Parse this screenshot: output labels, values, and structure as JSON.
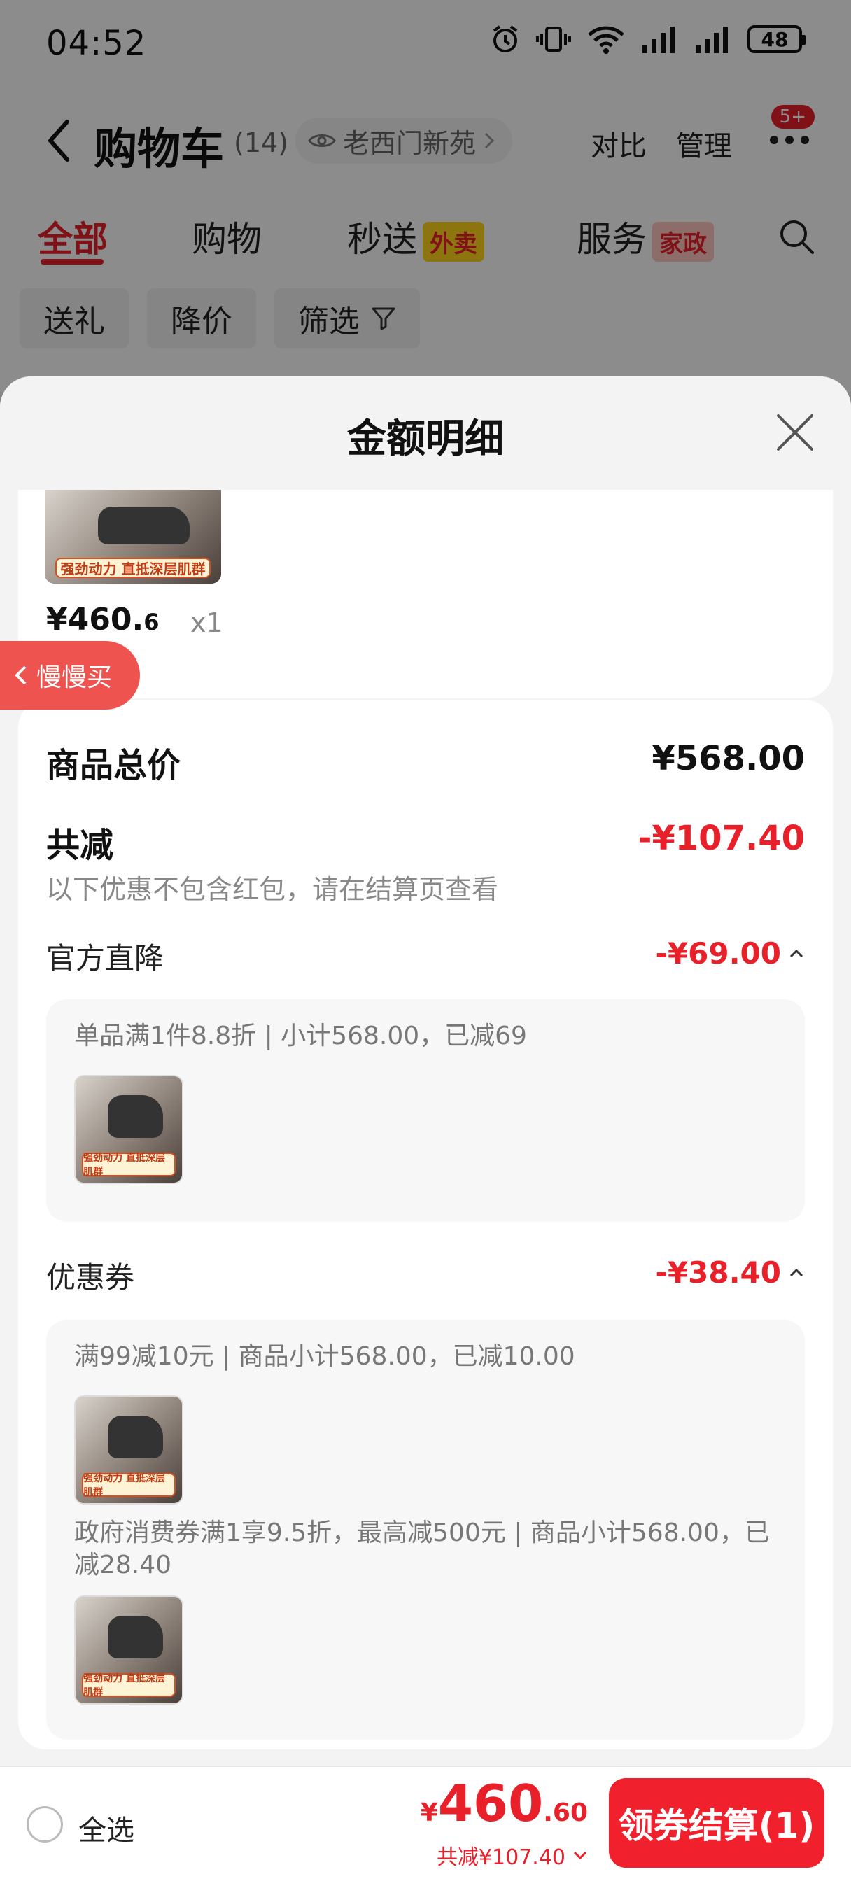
{
  "status_bar": {
    "time": "04:52",
    "battery": "48"
  },
  "nav": {
    "title": "购物车",
    "count": "(14)",
    "address": "老西门新苑",
    "compare": "对比",
    "manage": "管理",
    "more_badge": "5+"
  },
  "tabs": [
    {
      "label": "全部"
    },
    {
      "label": "购物"
    },
    {
      "label": "秒送",
      "tag": "外卖"
    },
    {
      "label": "服务",
      "tag": "家政"
    }
  ],
  "filters": {
    "gift": "送礼",
    "price_drop": "降价",
    "filter": "筛选"
  },
  "sheet": {
    "title": "金额明细",
    "product": {
      "price_main": "¥460.",
      "price_decimal": "6",
      "qty": "x1",
      "thumb_banner": "强劲动力 直抵深层肌群"
    },
    "slow_buy": "慢慢买",
    "total_label": "商品总价",
    "total_value": "¥568.00",
    "discount_label": "共减",
    "discount_value": "-¥107.40",
    "discount_hint": "以下优惠不包含红包，请在结算页查看",
    "official_label": "官方直降",
    "official_value": "-¥69.00",
    "official_detail": "单品满1件8.8折 | 小计568.00，已减69",
    "coupon_label": "优惠券",
    "coupon_value": "-¥38.40",
    "coupon_detail_1": "满99减10元 | 商品小计568.00，已减10.00",
    "coupon_detail_2": "政府消费券满1享9.5折，最高减500元 | 商品小计568.00，已减28.40",
    "thumb_banner": "强劲动力 直抵深层肌群"
  },
  "bottom_bar": {
    "select_all": "全选",
    "currency": "¥",
    "total_int": "460",
    "total_dec": ".60",
    "saved": "共减¥107.40",
    "checkout": "领券结算(1)"
  },
  "colors": {
    "accent_red": "#e8202a",
    "tag_yellow": "#ffd41c"
  }
}
